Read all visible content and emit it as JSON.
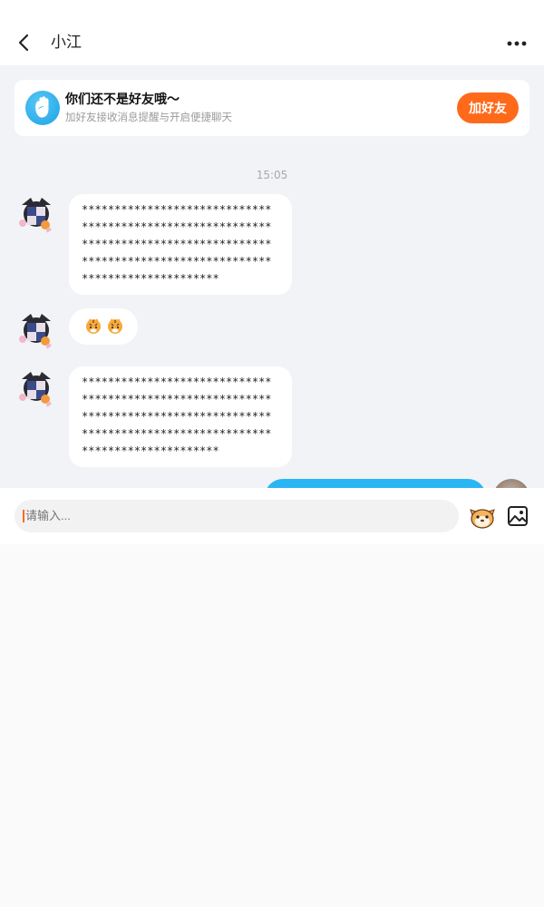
{
  "header": {
    "title": "小江",
    "back_icon": "back-arrow-icon",
    "more_icon": "more-dots-icon"
  },
  "friend_banner": {
    "title": "你们还不是好友哦～",
    "subtitle": "加好友接收消息提醒与开启便捷聊天",
    "button_label": "加好友",
    "icon": "wave-hand-icon",
    "accent_color": "#ff6a1a"
  },
  "chat": {
    "timestamp": "15:05",
    "messages": [
      {
        "lines": [
          "*****************************",
          "*****************************",
          "*****************************",
          "*****************************",
          "*********************"
        ]
      },
      {
        "emoji": [
          "tiger-emoji",
          "tiger-emoji"
        ]
      },
      {
        "lines": [
          "*****************************",
          "*****************************",
          "*****************************",
          "*****************************",
          "*********************"
        ]
      }
    ],
    "self_bubble_color": "#29b6f4"
  },
  "input": {
    "placeholder": "请输入...",
    "emoji_icon": "emoji-face-icon",
    "image_icon": "image-icon"
  }
}
